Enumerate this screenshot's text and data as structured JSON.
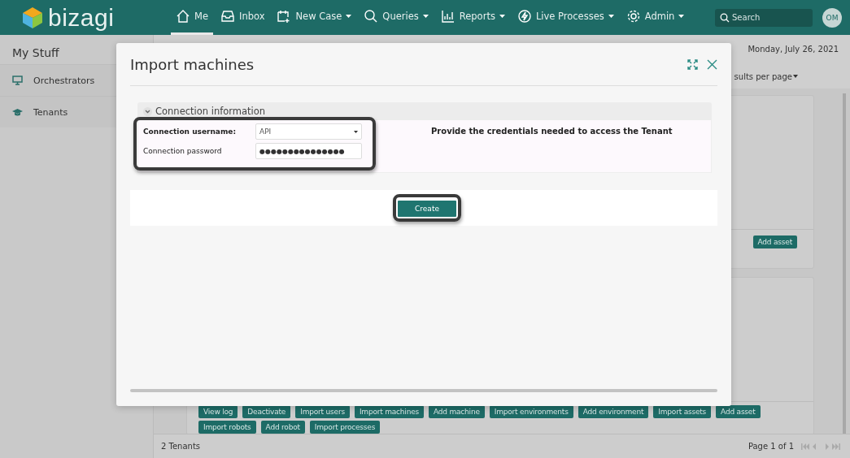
{
  "header": {
    "logo": "bizagi",
    "nav": [
      {
        "label": "Me",
        "dropdown": false,
        "selected": true
      },
      {
        "label": "Inbox",
        "dropdown": false,
        "selected": false
      },
      {
        "label": "New Case",
        "dropdown": true,
        "selected": false
      },
      {
        "label": "Queries",
        "dropdown": true,
        "selected": false
      },
      {
        "label": "Reports",
        "dropdown": true,
        "selected": false
      },
      {
        "label": "Live Processes",
        "dropdown": true,
        "selected": false
      },
      {
        "label": "Admin",
        "dropdown": true,
        "selected": false
      }
    ],
    "search": {
      "placeholder": "Search"
    },
    "avatar": "OM"
  },
  "sidebar": {
    "title": "My Stuff",
    "items": [
      {
        "label": "Orchestrators"
      },
      {
        "label": "Tenants"
      }
    ]
  },
  "main": {
    "date": "Monday, July 26, 2021",
    "results_per_page": "sults per page",
    "cards": [
      {
        "buttons": [
          "Add asset"
        ]
      },
      {
        "buttons": [
          "View log",
          "Deactivate",
          "Import users",
          "Import machines",
          "Add machine",
          "Import environments",
          "Add environment",
          "Import assets",
          "Add asset",
          "Import robots",
          "Add robot",
          "Import processes"
        ]
      }
    ],
    "footer": {
      "count": "2 Tenants",
      "page": "Page 1 of 1"
    }
  },
  "dialog": {
    "title": "Import machines",
    "section": {
      "title": "Connection information",
      "expanded": true,
      "fields": [
        {
          "label": "Connection username:",
          "kind": "select",
          "value": "API"
        },
        {
          "label": "Connection password",
          "kind": "password",
          "value": "●●●●●●●●●●●●●●●"
        }
      ],
      "hint": "Provide the credentials needed to access the Tenant"
    },
    "button": "Create"
  }
}
